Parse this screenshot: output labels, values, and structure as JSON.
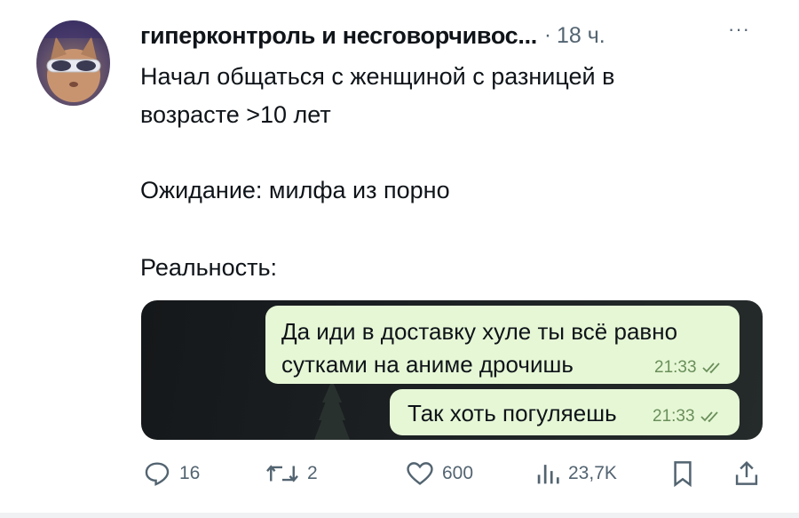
{
  "post": {
    "author": "гиперконтроль и несговорчивос...",
    "dot": "·",
    "time": "18 ч.",
    "more": "···",
    "text_lines": [
      "Начал общаться с женщиной с разницей в",
      "возрасте >10 лет",
      "Ожидание: милфа из порно",
      "Реальность:"
    ]
  },
  "chat": {
    "messages": [
      {
        "lines": [
          "Да иди в доставку хуле ты всё равно",
          "сутками на аниме дрочишь"
        ],
        "time": "21:33",
        "status_icon": "double-check-icon"
      },
      {
        "lines": [
          "Так хоть погуляешь"
        ],
        "time": "21:33",
        "status_icon": "double-check-icon"
      }
    ]
  },
  "actions": {
    "reply": {
      "icon": "reply-icon",
      "count": "16"
    },
    "repost": {
      "icon": "repost-icon",
      "count": "2"
    },
    "like": {
      "icon": "heart-icon",
      "count": "600"
    },
    "views": {
      "icon": "views-icon",
      "count": "23,7K"
    },
    "bookmark": {
      "icon": "bookmark-icon"
    },
    "share": {
      "icon": "share-icon"
    }
  },
  "colors": {
    "text": "#0f1419",
    "muted": "#536471",
    "bubble": "#e6f7d6",
    "chat_bg": "#1c2022"
  }
}
